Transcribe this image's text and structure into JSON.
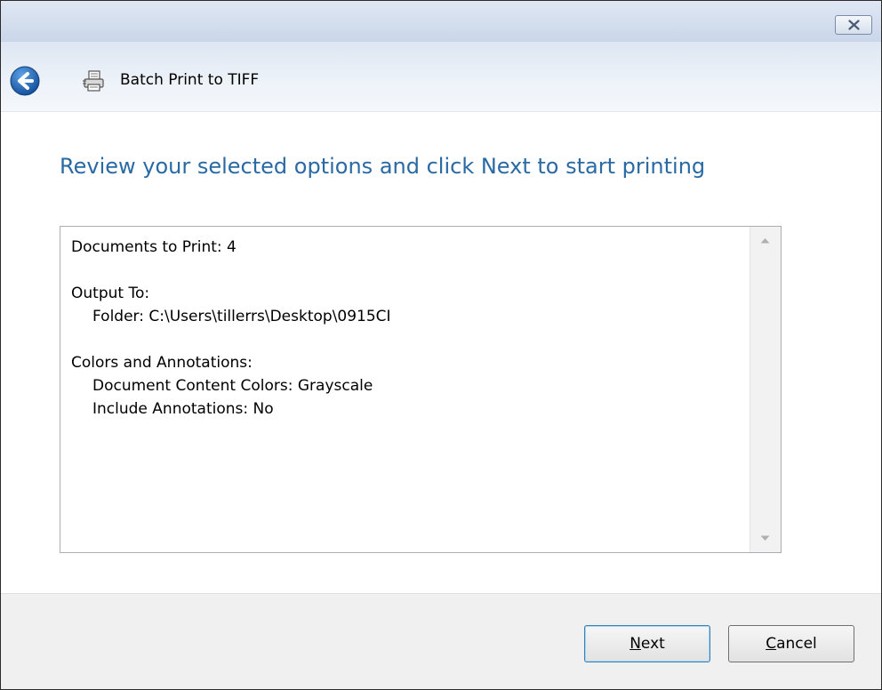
{
  "window": {
    "title": "Batch Print to TIFF",
    "close_glyph": "✕"
  },
  "icons": {
    "back": "back-arrow-icon",
    "app": "printer-icon",
    "close": "close-icon",
    "scroll_up": "scroll-up-arrow-icon",
    "scroll_down": "scroll-down-arrow-icon"
  },
  "page": {
    "heading": "Review your selected options and click Next to start printing"
  },
  "summary": {
    "documents_line": "Documents to Print: 4",
    "output_header": "Output To:",
    "output_folder": "Folder: C:\\Users\\tillerrs\\Desktop\\0915CI",
    "colors_header": "Colors and Annotations:",
    "content_colors": "Document Content Colors: Grayscale",
    "include_annotations": "Include Annotations: No"
  },
  "buttons": {
    "next_mnemonic": "N",
    "next_rest": "ext",
    "cancel_mnemonic": "C",
    "cancel_rest": "ancel"
  },
  "colors": {
    "heading": "#2a6aa4",
    "titlebar": "#d2dded",
    "back_button": "#1d65b8",
    "footer": "#f0f0f0"
  }
}
